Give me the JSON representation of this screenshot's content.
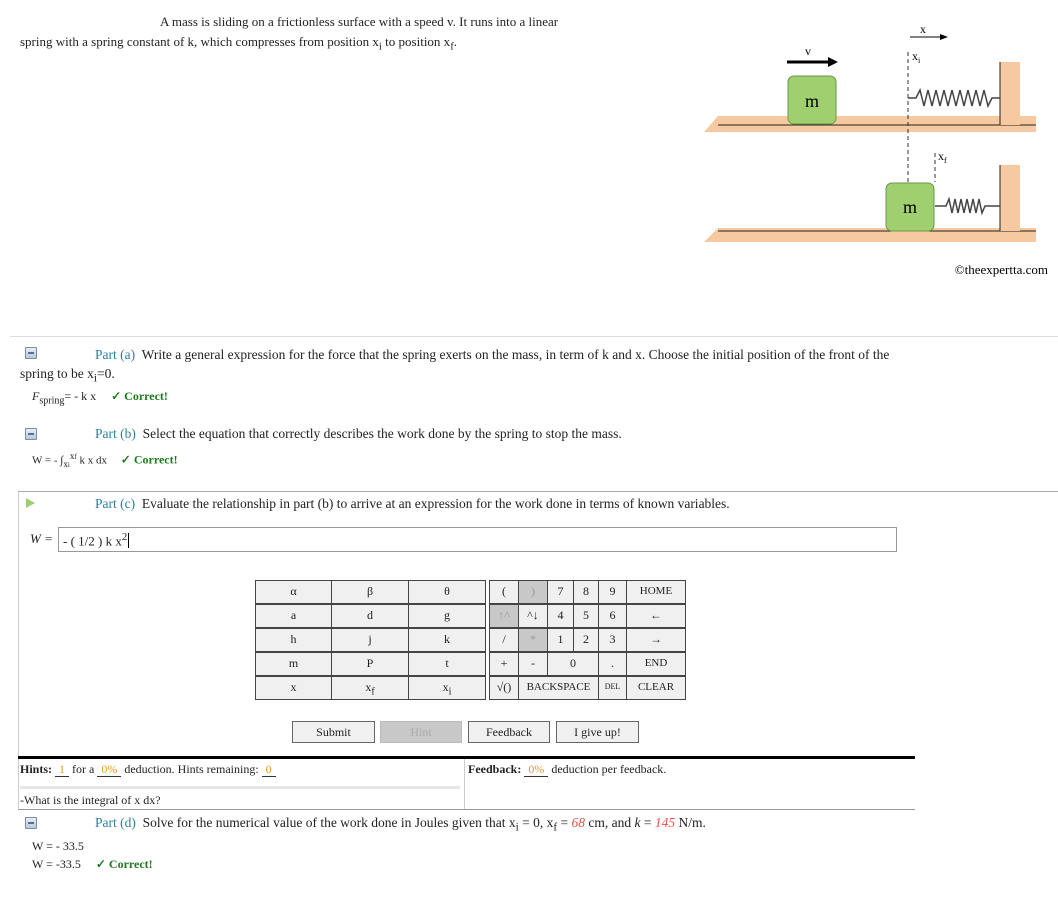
{
  "problem": {
    "line1": "A mass is sliding on a frictionless surface with a speed v. It runs into a linear",
    "line2": "spring with a spring constant of k, which compresses from position x",
    "line2_sub": "i",
    "line2_mid": " to position x",
    "line2_sub2": "f",
    "line2_end": "."
  },
  "diagram": {
    "v": "v",
    "x": "x",
    "xi": "x",
    "xi_sub": "i",
    "xf": "x",
    "xf_sub": "f",
    "mass": "m",
    "copyright": "©theexpertta.com",
    "colors": {
      "block": "#9fcf6e",
      "floor": "#f6c9a0"
    }
  },
  "part_a": {
    "label": "Part (a)",
    "text": "Write a general expression for the force that the spring exerts on the mass, in term of k and x. Choose the initial position of the front of the",
    "text2": "spring to be x",
    "text2_sub": "i",
    "text2_end": "=0.",
    "answer_lhs": "F",
    "answer_sub": "spring",
    "answer": "= - k x",
    "status": "✓ Correct!"
  },
  "part_b": {
    "label": "Part (b)",
    "text": "Select the equation that correctly describes the work done by the spring to stop the mass.",
    "answer_pre": "W = - ∫",
    "answer_lower": "x",
    "answer_lower_sub": "i",
    "answer_upper": "x",
    "answer_upper_sub": "f",
    "answer_post": " k x dx",
    "status": "✓ Correct!"
  },
  "part_c": {
    "label": "Part (c)",
    "text": "Evaluate the relationship in part (b) to arrive at an expression for the work done in terms of known variables.",
    "input_label": "W =",
    "input_value": "- ( 1/2 ) k x",
    "input_sup": "2"
  },
  "keypad": {
    "vars": [
      [
        "α",
        "β",
        "θ"
      ],
      [
        "a",
        "d",
        "g"
      ],
      [
        "h",
        "j",
        "k"
      ],
      [
        "m",
        "P",
        "t"
      ],
      [
        "x",
        "x_f",
        "x_i"
      ]
    ],
    "row1": [
      "(",
      ")",
      "7",
      "8",
      "9",
      "HOME"
    ],
    "row2": [
      "↑^",
      "^↓",
      "4",
      "5",
      "6",
      "←"
    ],
    "row3": [
      "/",
      "*",
      "1",
      "2",
      "3",
      "→"
    ],
    "row4": [
      "+",
      "-",
      "0",
      ".",
      "END"
    ],
    "row5": [
      "√()",
      "BACKSPACE",
      "DEL",
      "CLEAR"
    ]
  },
  "buttons": {
    "submit": "Submit",
    "hint": "Hint",
    "feedback": "Feedback",
    "give_up": "I give up!"
  },
  "hints": {
    "label": "Hints:",
    "count": "1",
    "for_a": "for a",
    "deduction": "0%",
    "deduction_text": "deduction. Hints remaining:",
    "remaining": "0",
    "hint_text": "-What is the integral of x dx?"
  },
  "feedback": {
    "label": "Feedback:",
    "deduction": "0%",
    "text": "deduction per feedback."
  },
  "part_d": {
    "label": "Part (d)",
    "text": "Solve for the numerical value of the work done in Joules given that x",
    "xi_sub": "i",
    "t2": " = 0, x",
    "xf_sub": "f",
    "t3": " = ",
    "xf_val": "68",
    "t4": " cm, and ",
    "k": "k",
    "t5": " = ",
    "k_val": "145",
    "t6": " N/m.",
    "answer1": "W = - 33.5",
    "answer2": "W = -33.5",
    "status": "✓ Correct!"
  }
}
